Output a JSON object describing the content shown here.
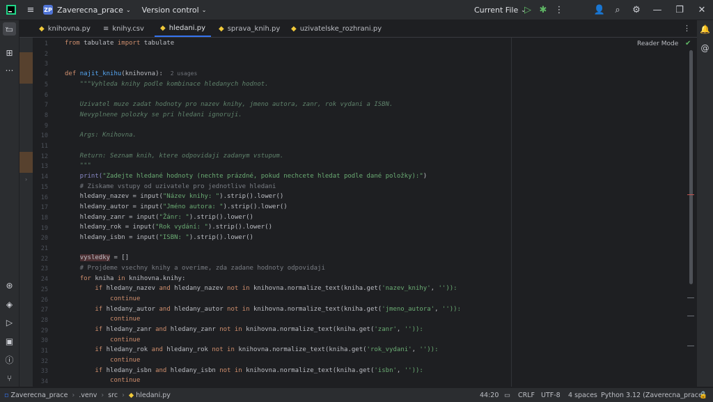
{
  "titlebar": {
    "project_badge": "ZP",
    "project_name": "Zaverecna_prace",
    "vcs_label": "Version control",
    "run_config": "Current File"
  },
  "tabs": [
    {
      "label": "knihovna.py",
      "icon": "python-file-icon"
    },
    {
      "label": "knihy.csv",
      "icon": "text-file-icon"
    },
    {
      "label": "hledani.py",
      "icon": "python-file-icon",
      "active": true
    },
    {
      "label": "sprava_knih.py",
      "icon": "python-file-icon"
    },
    {
      "label": "uzivatelske_rozhrani.py",
      "icon": "python-file-icon"
    }
  ],
  "editor": {
    "reader_mode": "Reader Mode",
    "usages_hint": "2 usages",
    "line_numbers": [
      "1",
      "2",
      "3",
      "4",
      "5",
      "6",
      "7",
      "8",
      "9",
      "10",
      "11",
      "12",
      "13",
      "14",
      "15",
      "16",
      "17",
      "18",
      "19",
      "20",
      "21",
      "22",
      "23",
      "24",
      "25",
      "26",
      "27",
      "28",
      "29",
      "30",
      "31",
      "32",
      "33",
      "34"
    ],
    "code": {
      "l1": "from tabulate import tabulate",
      "l4_def": "def ",
      "l4_name": "najit_knihu",
      "l4_rest": "(knihovna):",
      "l5": "    \"\"\"Vyhleda knihy podle kombinace hledanych hodnot.",
      "l7": "    Uzivatel muze zadat hodnoty pro nazev knihy, jmeno autora, zanr, rok vydani a ISBN.",
      "l8": "    Nevyplnene polozky se pri hledani ignoruji.",
      "l10": "    Args: Knihovna.",
      "l12": "    Return: Seznam knih, ktere odpovidaji zadanym vstupum.",
      "l13": "    \"\"\"",
      "l14_a": "    print(",
      "l14_s": "\"Zadejte hledané hodnoty (nechte prázdné, pokud nechcete hledat podle dané položky):\"",
      "l14_b": ")",
      "l15": "    # Ziskame vstupy od uzivatele pro jednotlive hledani",
      "l16_a": "    hledany_nazev = input(",
      "l16_s": "\"Název knihy: \"",
      "l16_b": ").strip().lower()",
      "l17_a": "    hledany_autor = input(",
      "l17_s": "\"Jméno autora: \"",
      "l17_b": ").strip().lower()",
      "l18_a": "    hledany_zanr = input(",
      "l18_s": "\"Žánr: \"",
      "l18_b": ").strip().lower()",
      "l19_a": "    hledany_rok = input(",
      "l19_s": "\"Rok vydání: \"",
      "l19_b": ").strip().lower()",
      "l20_a": "    hledany_isbn = input(",
      "l20_s": "\"ISBN: \"",
      "l20_b": ").strip().lower()",
      "l22_v": "vysledky",
      "l22_b": " = []",
      "l23": "    # Projdeme vsechny knihy a overime, zda zadane hodnoty odpovidaji",
      "l24": "knihovna.knihy:",
      "l25_a": "hledany_nazev ",
      "l25_b": "hledany_nazev ",
      "l25_c": "knihovna.normalize_text(kniha.get(",
      "l25_s": "'nazev_knihy'",
      "l25_d": "'')):",
      "l27_a": "hledany_autor ",
      "l27_b": "hledany_autor ",
      "l27_s": "'jmeno_autora'",
      "l29_a": "hledany_zanr ",
      "l29_b": "hledany_zanr ",
      "l29_s": "'zanr'",
      "l31_a": "hledany_rok ",
      "l31_b": "hledany_rok ",
      "l31_s": "'rok_vydani'",
      "l33_a": "hledany_isbn ",
      "l33_b": "hledany_isbn ",
      "l33_s": "'isbn'",
      "continue": "continue"
    }
  },
  "statusbar": {
    "crumbs": [
      "Zaverecna_prace",
      ".venv",
      "src",
      "hledani.py"
    ],
    "position": "44:20",
    "line_sep": "CRLF",
    "encoding": "UTF-8",
    "indent": "4 spaces",
    "interpreter": "Python 3.12 (Zaverecna_prace)"
  },
  "colors": {
    "accent": "#3574f0",
    "keyword": "#cf8e6d",
    "string": "#6aab73",
    "function": "#56a8f5",
    "comment": "#7a7e85",
    "docstring": "#5f826b"
  }
}
